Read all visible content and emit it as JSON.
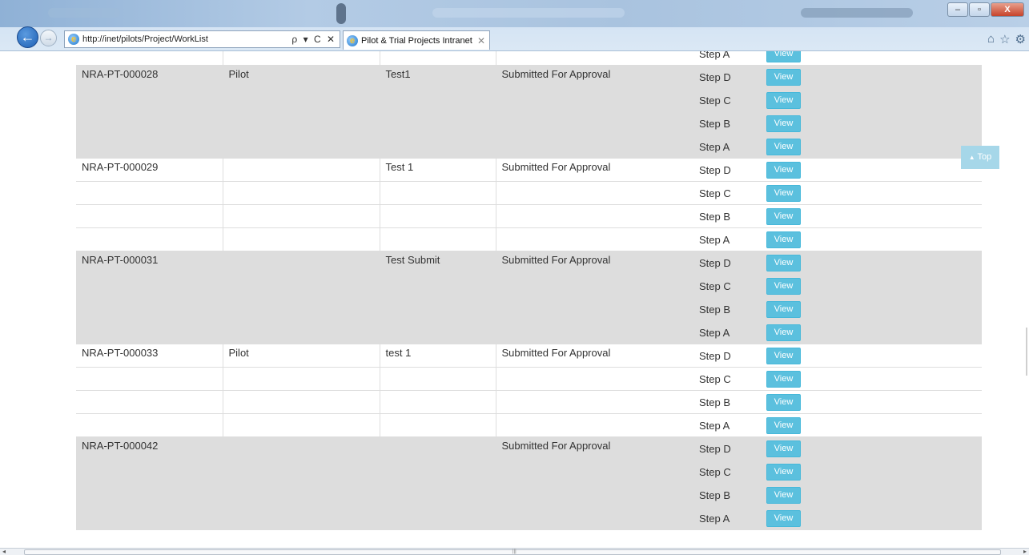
{
  "browser": {
    "address_url": "http://inet/pilots/Project/WorkList",
    "address_controls": "ρ ▾ C ✕",
    "tab_title": "Pilot & Trial Projects Intranet",
    "tab_close": "✕",
    "back_glyph": "←",
    "forward_glyph": "→",
    "window_buttons": {
      "minimize": "–",
      "maximize": "▫",
      "close": "X"
    },
    "toolbar_icons": [
      "home-icon",
      "favorites-star-icon",
      "settings-gear-icon"
    ],
    "toolbar_glyphs": {
      "home": "⌂",
      "favorites": "☆",
      "settings": "⚙"
    }
  },
  "top_button": {
    "label": "Top",
    "glyph": "▲"
  },
  "colors": {
    "view_button": "#5bc0de",
    "shaded_row": "#dddddd",
    "top_button": "#a6d7e9"
  },
  "view_label": "View",
  "clipped_row": {
    "step": "Step A"
  },
  "projects": [
    {
      "id": "NRA-PT-000028",
      "type": "Pilot",
      "name": "Test1",
      "status": "Submitted For Approval",
      "shaded": true,
      "steps": [
        "Step D",
        "Step C",
        "Step B",
        "Step A"
      ]
    },
    {
      "id": "NRA-PT-000029",
      "type": "",
      "name": "Test 1",
      "status": "Submitted For Approval",
      "shaded": false,
      "steps": [
        "Step D",
        "Step C",
        "Step B",
        "Step A"
      ]
    },
    {
      "id": "NRA-PT-000031",
      "type": "",
      "name": "Test Submit",
      "status": "Submitted For Approval",
      "shaded": true,
      "steps": [
        "Step D",
        "Step C",
        "Step B",
        "Step A"
      ]
    },
    {
      "id": "NRA-PT-000033",
      "type": "Pilot",
      "name": "test 1",
      "status": "Submitted For Approval",
      "shaded": false,
      "steps": [
        "Step D",
        "Step C",
        "Step B",
        "Step A"
      ]
    },
    {
      "id": "NRA-PT-000042",
      "type": "",
      "name": "",
      "status": "Submitted For Approval",
      "shaded": true,
      "steps": [
        "Step D",
        "Step C",
        "Step B",
        "Step A"
      ]
    }
  ]
}
